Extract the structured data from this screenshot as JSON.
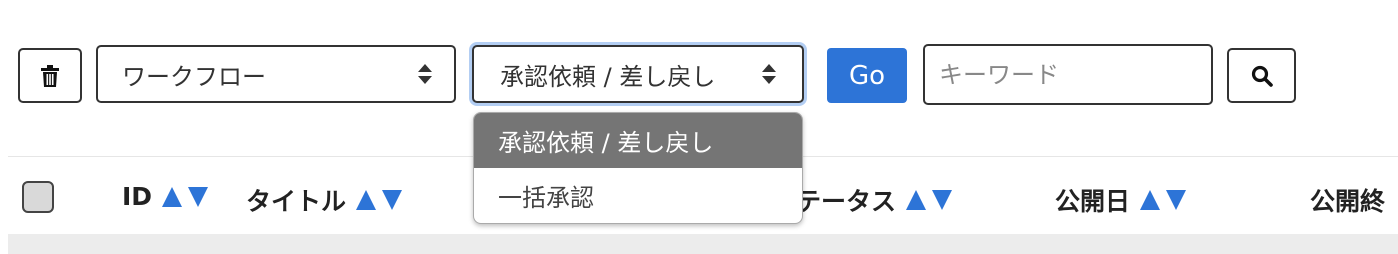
{
  "toolbar": {
    "delete_icon": "trash-icon",
    "workflow_select": {
      "value": "ワークフロー"
    },
    "action_select": {
      "value": "承認依頼 / 差し戻し",
      "options": [
        "承認依頼 / 差し戻し",
        "一括承認"
      ],
      "selected_index": 0
    },
    "go_label": "Go",
    "keyword": {
      "value": "",
      "placeholder": "キーワード"
    },
    "search_icon": "search-icon"
  },
  "table": {
    "columns": [
      "ID",
      "タイトル",
      "ステータス",
      "公開日",
      "公開終"
    ],
    "visible_column_fragments": {
      "status": "テータス"
    }
  },
  "colors": {
    "accent": "#2d74d7",
    "selected_option_bg": "#757575"
  }
}
